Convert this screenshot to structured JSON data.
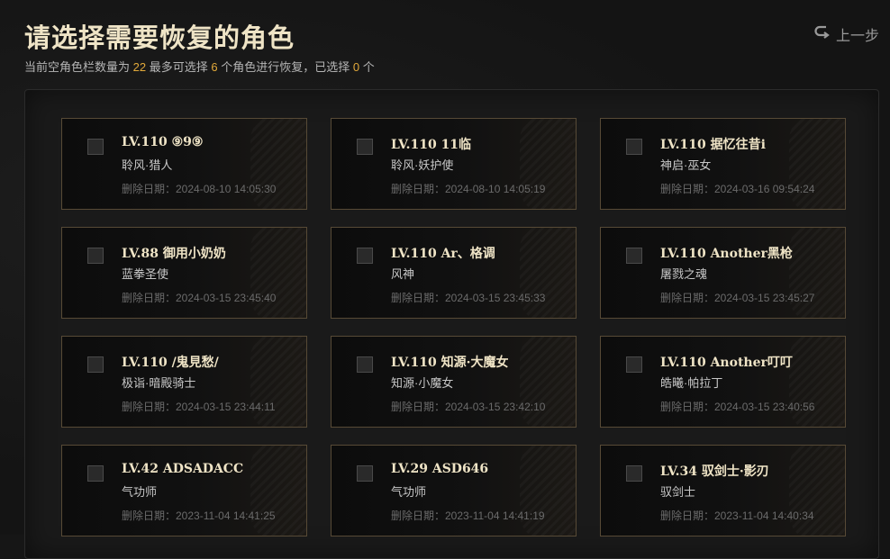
{
  "header": {
    "title": "请选择需要恢复的角色",
    "subtitle_pre": "当前空角色栏数量为",
    "empty_slots": "22",
    "subtitle_mid": "最多可选择",
    "max_select": "6",
    "subtitle_mid2": "个角色进行恢复，已选择",
    "selected": "0",
    "subtitle_post": "个",
    "back_label": "上一步"
  },
  "colors": {
    "accent": "#e2a93a",
    "title": "#efe4c6",
    "border": "#574a36"
  },
  "characters": [
    {
      "name": "LV.110 ⑨9⑨",
      "class": "聆风·猎人",
      "deleted": "删除日期：2024-08-10 14:05:30"
    },
    {
      "name": "LV.110 11临",
      "class": "聆风·妖护使",
      "deleted": "删除日期：2024-08-10 14:05:19"
    },
    {
      "name": "LV.110 据忆往昔i",
      "class": "神启·巫女",
      "deleted": "删除日期：2024-03-16 09:54:24"
    },
    {
      "name": "LV.88 御用小奶奶",
      "class": "蓝拳圣使",
      "deleted": "删除日期：2024-03-15 23:45:40"
    },
    {
      "name": "LV.110 Ar、格调",
      "class": "风神",
      "deleted": "删除日期：2024-03-15 23:45:33"
    },
    {
      "name": "LV.110 Another黑枪",
      "class": "屠戮之魂",
      "deleted": "删除日期：2024-03-15 23:45:27"
    },
    {
      "name": "LV.110 /鬼見愁/",
      "class": "极诣·暗殿骑士",
      "deleted": "删除日期：2024-03-15 23:44:11"
    },
    {
      "name": "LV.110 知源·大魔女",
      "class": "知源·小魔女",
      "deleted": "删除日期：2024-03-15 23:42:10"
    },
    {
      "name": "LV.110 Another叮叮",
      "class": "皓曦·帕拉丁",
      "deleted": "删除日期：2024-03-15 23:40:56"
    },
    {
      "name": "LV.42 ADSADACC",
      "class": "气功师",
      "deleted": "删除日期：2023-11-04 14:41:25"
    },
    {
      "name": "LV.29 ASD646",
      "class": "气功师",
      "deleted": "删除日期：2023-11-04 14:41:19"
    },
    {
      "name": "LV.34 驭剑士·影刃",
      "class": "驭剑士",
      "deleted": "删除日期：2023-11-04 14:40:34"
    }
  ]
}
